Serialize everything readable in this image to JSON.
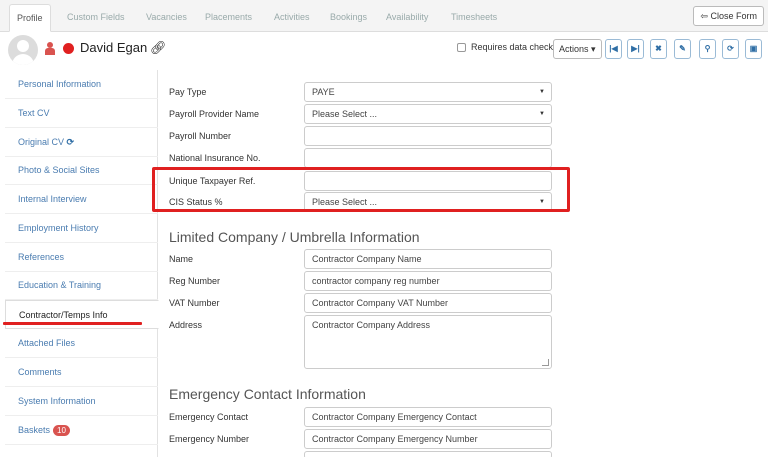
{
  "tabs": [
    "Profile",
    "Custom Fields",
    "Vacancies",
    "Placements",
    "Activities",
    "Bookings",
    "Availability",
    "Timesheets"
  ],
  "close_form_label": "Close Form",
  "header": {
    "name": "David Egan",
    "requires_data_check_label": "Requires data check",
    "actions_label": "Actions",
    "icon_buttons": [
      "first-icon",
      "last-icon",
      "close-icon",
      "edit-icon",
      "attach-icon",
      "refresh-icon",
      "save-icon"
    ]
  },
  "sidebar": {
    "items": [
      {
        "label": "Personal Information"
      },
      {
        "label": "Text CV"
      },
      {
        "label": "Original CV",
        "icon": "refresh-icon"
      },
      {
        "label": "Photo & Social Sites"
      },
      {
        "label": "Internal Interview"
      },
      {
        "label": "Employment History"
      },
      {
        "label": "References"
      },
      {
        "label": "Education & Training"
      },
      {
        "label": "Contractor/Temps Info",
        "active": true
      },
      {
        "label": "Attached Files"
      },
      {
        "label": "Comments"
      },
      {
        "label": "System Information"
      },
      {
        "label": "Baskets",
        "badge": "10"
      }
    ]
  },
  "form": {
    "pay_type": {
      "label": "Pay Type",
      "value": "PAYE"
    },
    "payroll_provider": {
      "label": "Payroll Provider Name",
      "value": "Please Select ..."
    },
    "payroll_number": {
      "label": "Payroll Number",
      "value": ""
    },
    "ni_number": {
      "label": "National Insurance No.",
      "value": ""
    },
    "utr": {
      "label": "Unique Taxpayer Ref.",
      "value": ""
    },
    "cis_status": {
      "label": "CIS Status %",
      "value": "Please Select ..."
    }
  },
  "limited_company": {
    "title": "Limited Company / Umbrella Information",
    "name": {
      "label": "Name",
      "value": "Contractor  Company Name"
    },
    "reg_number": {
      "label": "Reg Number",
      "value": "contractor company reg number"
    },
    "vat_number": {
      "label": "VAT Number",
      "value": "Contractor Company VAT Number"
    },
    "address": {
      "label": "Address",
      "value": "Contractor Company Address"
    }
  },
  "emergency": {
    "title": "Emergency Contact Information",
    "contact": {
      "label": "Emergency Contact",
      "value": "Contractor Company Emergency Contact"
    },
    "number": {
      "label": "Emergency Number",
      "value": "Contractor Company Emergency Number"
    }
  }
}
